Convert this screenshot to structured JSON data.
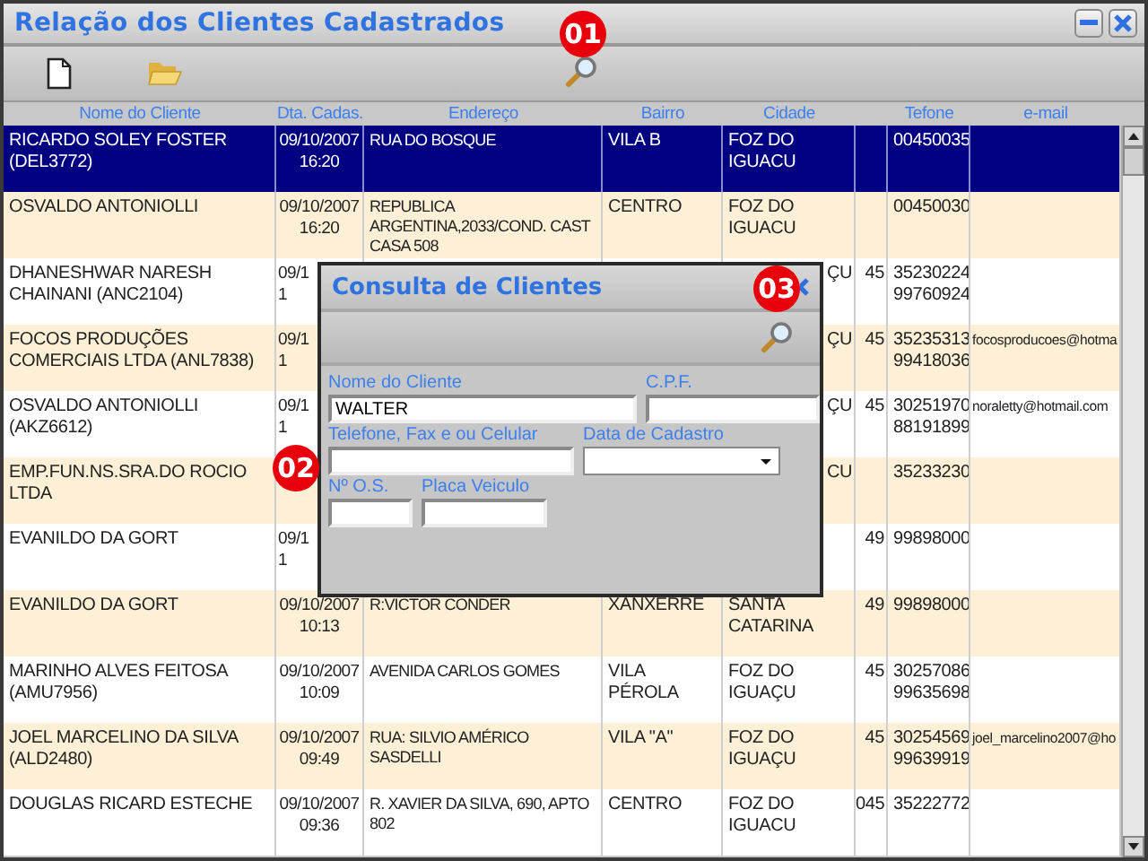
{
  "window": {
    "title": "Relação dos Clientes Cadastrados"
  },
  "table": {
    "columns": [
      "Nome do Cliente",
      "Dta. Cadas.",
      "Endereço",
      "Bairro",
      "Cidade",
      null,
      "Tefone",
      "e-mail"
    ],
    "rows": [
      {
        "kind": "full",
        "selected": true,
        "cells": [
          "RICARDO SOLEY FOSTER (DEL3772)",
          "09/10/2007\n16:20",
          "RUA DO BOSQUE",
          "VILA B",
          "FOZ DO IGUACU",
          null,
          "00450035",
          null
        ]
      },
      {
        "kind": "full",
        "selected": false,
        "cells": [
          "OSVALDO ANTONIOLLI",
          "09/10/2007\n16:20",
          "REPUBLICA ARGENTINA,2033/COND. CAST\n CASA 508",
          "CENTRO",
          "FOZ DO IGUACU",
          null,
          "00450030",
          null
        ]
      },
      {
        "kind": "partly_hidden",
        "selected": false,
        "cells": [
          "DHANESHWAR NARESH CHAINANI (ANC2104)",
          "09/1\n1",
          null,
          null,
          "ÇU",
          "45",
          "35230224\n99760924",
          null
        ]
      },
      {
        "kind": "partly_hidden",
        "selected": false,
        "cells": [
          "FOCOS PRODUÇÕES COMERCIAIS LTDA (ANL7838)",
          "09/1\n1",
          null,
          null,
          "ÇU",
          "45",
          "35235313\n99418036",
          "focosproducoes@hotma"
        ]
      },
      {
        "kind": "partly_hidden",
        "selected": false,
        "cells": [
          "OSVALDO ANTONIOLLI (AKZ6612)",
          "09/1\n1",
          null,
          null,
          "ÇU",
          "45",
          "30251970\n88191899",
          "noraletty@hotmail.com"
        ]
      },
      {
        "kind": "partly_hidden",
        "selected": false,
        "cells": [
          "EMP.FUN.NS.SRA.DO ROCIO LTDA",
          null,
          null,
          null,
          "CU",
          null,
          "35233230",
          null
        ]
      },
      {
        "kind": "partly_hidden",
        "selected": false,
        "cells": [
          "EVANILDO DA GORT",
          "09/1\n1",
          null,
          null,
          null,
          "49",
          "99898000",
          null
        ]
      },
      {
        "kind": "full",
        "selected": false,
        "cells": [
          "EVANILDO DA GORT",
          "09/10/2007\n10:13",
          "R:VICTOR CONDER",
          "XANXERRE",
          "SANTA CATARINA",
          "49",
          "99898000",
          null
        ]
      },
      {
        "kind": "full",
        "selected": false,
        "cells": [
          "MARINHO ALVES FEITOSA (AMU7956)",
          "09/10/2007\n10:09",
          "AVENIDA CARLOS GOMES",
          "VILA PÉROLA",
          "FOZ DO IGUAÇU",
          "45",
          "30257086\n99635698",
          null
        ]
      },
      {
        "kind": "full",
        "selected": false,
        "cells": [
          "JOEL MARCELINO DA SILVA (ALD2480)",
          "09/10/2007\n09:49",
          "RUA: SILVIO AMÉRICO SASDELLI",
          "VILA \"A\"",
          "FOZ DO IGUAÇU",
          "45",
          "30254569\n99639919",
          "joel_marcelino2007@ho"
        ]
      },
      {
        "kind": "full",
        "selected": false,
        "cells": [
          "DOUGLAS RICARD ESTECHE",
          "09/10/2007\n09:36",
          "R. XAVIER DA SILVA, 690, APTO 802",
          "CENTRO",
          "FOZ DO IGUACU",
          "045",
          "35222772",
          null
        ]
      }
    ]
  },
  "search_dialog": {
    "title": "Consulta de Clientes",
    "fields": [
      {
        "label": "Nome do Cliente",
        "kind": "text",
        "value": "WALTER"
      },
      {
        "label": "C.P.F.",
        "kind": "text"
      },
      {
        "label": "Telefone, Fax e ou Celular",
        "kind": "text"
      },
      {
        "label": "Data de Cadastro",
        "kind": "dropdown"
      },
      {
        "label": "Nº O.S.",
        "kind": "text"
      },
      {
        "label": "Placa Veiculo",
        "kind": "text"
      }
    ]
  },
  "callouts": [
    {
      "label": "01"
    },
    {
      "label": "02"
    },
    {
      "label": "03"
    }
  ]
}
